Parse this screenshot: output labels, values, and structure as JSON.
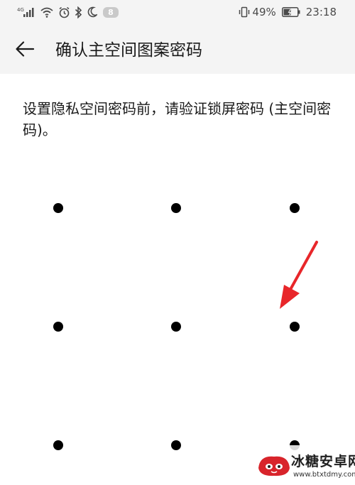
{
  "status_bar": {
    "network_type": "4G",
    "notification_count": "8",
    "battery_percent": "49%",
    "time": "23:18",
    "icons": [
      "signal-icon",
      "wifi-icon",
      "alarm-icon",
      "bluetooth-icon",
      "moon-icon",
      "vibrate-icon",
      "battery-icon"
    ]
  },
  "header": {
    "title": "确认主空间图案密码",
    "back_icon": "back-arrow-icon"
  },
  "instruction": "设置隐私空间密码前，请验证锁屏密码 (主空间密码)。",
  "pattern": {
    "rows": 3,
    "cols": 3,
    "dot_color": "#000000"
  },
  "annotation": {
    "type": "red-arrow",
    "color": "#e8262a",
    "points_to": "pattern-dot-6"
  },
  "watermark": {
    "title": "冰糖安卓网",
    "url": "www.btxtdmy.com",
    "accent": "#d8242b"
  }
}
